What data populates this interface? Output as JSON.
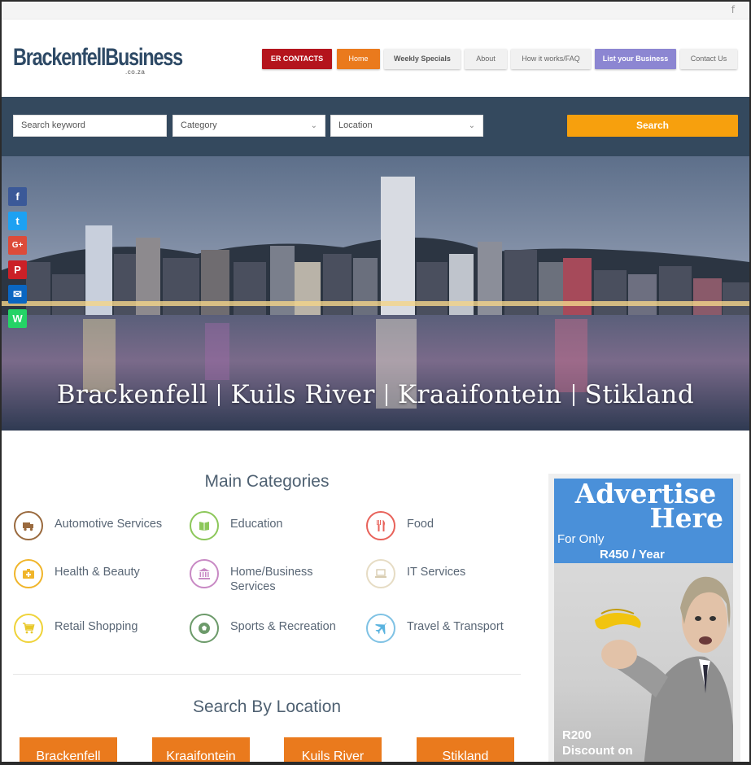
{
  "topbar": {
    "facebook_icon": "f"
  },
  "logo": {
    "part1": "Brackenfell",
    "part2": "Business",
    "tld": ".co.za"
  },
  "nav": {
    "er_contacts": "ER CONTACTS",
    "home": "Home",
    "weekly_specials": "Weekly Specials",
    "about": "About",
    "how_it_works": "How it works/FAQ",
    "list_business": "List your Business",
    "contact_us": "Contact Us"
  },
  "search": {
    "keyword_placeholder": "Search keyword",
    "category": "Category",
    "location": "Location",
    "button": "Search"
  },
  "hero": {
    "towns": [
      "Brackenfell",
      "Kuils River",
      "Kraaifontein",
      "Stikland"
    ]
  },
  "social": {
    "facebook": "f",
    "twitter": "t",
    "google_plus": "G+",
    "pinterest": "P",
    "email": "✉",
    "whatsapp": "W"
  },
  "categories": {
    "title": "Main Categories",
    "items": [
      {
        "label": "Automotive Services",
        "icon": "truck-icon",
        "color": "#9a6a3e"
      },
      {
        "label": "Education",
        "icon": "book-icon",
        "color": "#8cc75a"
      },
      {
        "label": "Food",
        "icon": "cutlery-icon",
        "color": "#e8625a"
      },
      {
        "label": "Health & Beauty",
        "icon": "medkit-icon",
        "color": "#f0b52a"
      },
      {
        "label": "Home/Business Services",
        "icon": "bank-icon",
        "color": "#c889c4"
      },
      {
        "label": "IT Services",
        "icon": "laptop-icon",
        "color": "#e6dcc4"
      },
      {
        "label": "Retail Shopping",
        "icon": "cart-icon",
        "color": "#efd33a"
      },
      {
        "label": "Sports & Recreation",
        "icon": "soccer-ball-icon",
        "color": "#6c9a6a"
      },
      {
        "label": "Travel & Transport",
        "icon": "plane-icon",
        "color": "#7fc2e4"
      }
    ]
  },
  "locations": {
    "title": "Search By Location",
    "items": [
      "Brackenfell",
      "Kraaifontein",
      "Kuils River",
      "Stikland"
    ]
  },
  "ad": {
    "headline1": "Advertise",
    "headline2": "Here",
    "for_only": "For Only",
    "price": "R450 / Year",
    "discount_line1": "R200",
    "discount_line2": "Discount on"
  }
}
